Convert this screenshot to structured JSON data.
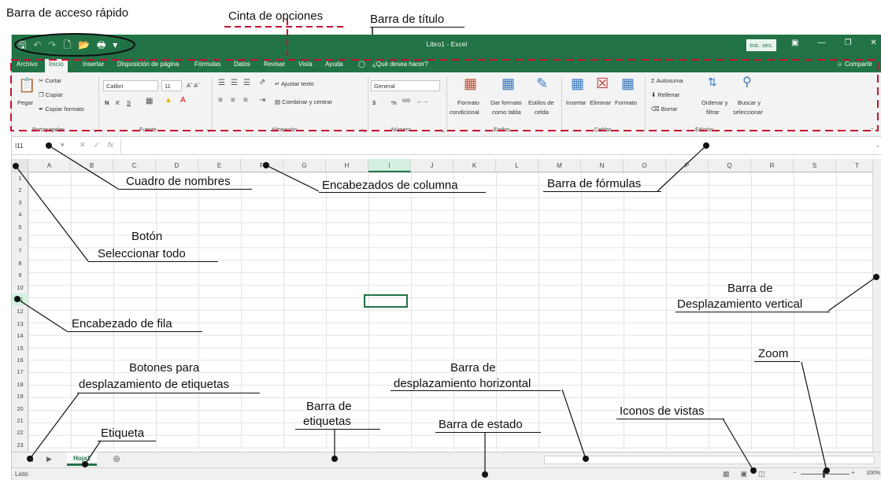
{
  "app": {
    "title": "Libro1 - Excel",
    "signin": "Inic. ses.",
    "share": "Compartir"
  },
  "tabs": [
    "Archivo",
    "Inicio",
    "Insertar",
    "Disposición de página",
    "Fórmulas",
    "Datos",
    "Revisar",
    "Vista",
    "Ayuda",
    "¿Qué desea hacer?"
  ],
  "ribbon": {
    "portapapeles": {
      "label": "Portapapeles",
      "paste": "Pegar",
      "cut": "Cortar",
      "copy": "Copiar",
      "format_painter": "Copiar formato"
    },
    "fuente": {
      "label": "Fuente",
      "font": "Calibri",
      "size": "11",
      "bold": "N",
      "italic": "K",
      "underline": "S"
    },
    "alineacion": {
      "label": "Alineación",
      "wrap": "Ajustar texto",
      "merge": "Combinar y centrar"
    },
    "numero": {
      "label": "Número",
      "format": "General",
      "currency": "$",
      "percent": "%",
      "thousands": "000"
    },
    "estilos": {
      "label": "Estilos",
      "cond1": "Formato",
      "cond2": "condicional",
      "table1": "Dar formato",
      "table2": "como tabla",
      "cell1": "Estilos de",
      "cell2": "celda"
    },
    "celdas": {
      "label": "Celdas",
      "insert": "Insertar",
      "delete": "Eliminar",
      "format": "Formato"
    },
    "edicion": {
      "label": "Edición",
      "autosum": "Autosuma",
      "fill": "Rellenar",
      "clear": "Borrar",
      "sort1": "Ordenar y",
      "sort2": "filtrar",
      "find1": "Buscar y",
      "find2": "seleccionar"
    }
  },
  "formula_bar": {
    "name_box": "I11",
    "fx": "fx"
  },
  "columns": [
    "A",
    "B",
    "C",
    "D",
    "E",
    "F",
    "G",
    "H",
    "I",
    "J",
    "K",
    "L",
    "M",
    "N",
    "O",
    "P",
    "Q",
    "R",
    "S",
    "T"
  ],
  "selected_column": "I",
  "rows": [
    "1",
    "2",
    "3",
    "4",
    "5",
    "6",
    "7",
    "8",
    "9",
    "10",
    "11",
    "12",
    "13",
    "14",
    "15",
    "16",
    "17",
    "18",
    "19",
    "20",
    "21",
    "22",
    "23"
  ],
  "selected_row": "11",
  "sheet_tab": "Hoja1",
  "status": {
    "text": "Listo",
    "zoom": "100%"
  },
  "annotations": {
    "qat": "Barra de acceso rápido",
    "ribbon": "Cinta de opciones",
    "titlebar": "Barra de título",
    "namebox": "Cuadro de nombres",
    "colheaders": "Encabezados de columna",
    "formulabar": "Barra de fórmulas",
    "selectall1": "Botón",
    "selectall2": "Seleccionar todo",
    "vscroll1": "Barra de",
    "vscroll2": "Desplazamiento vertical",
    "rowheader": "Encabezado de fila",
    "tabnav1": "Botones para",
    "tabnav2": "desplazamiento de etiquetas",
    "hscroll1": "Barra de",
    "hscroll2": "desplazamiento horizontal",
    "zoom": "Zoom",
    "tabbar1": "Barra de",
    "tabbar2": "etiquetas",
    "views": "Iconos de vistas",
    "tab": "Etiqueta",
    "statusbar": "Barra de estado"
  }
}
